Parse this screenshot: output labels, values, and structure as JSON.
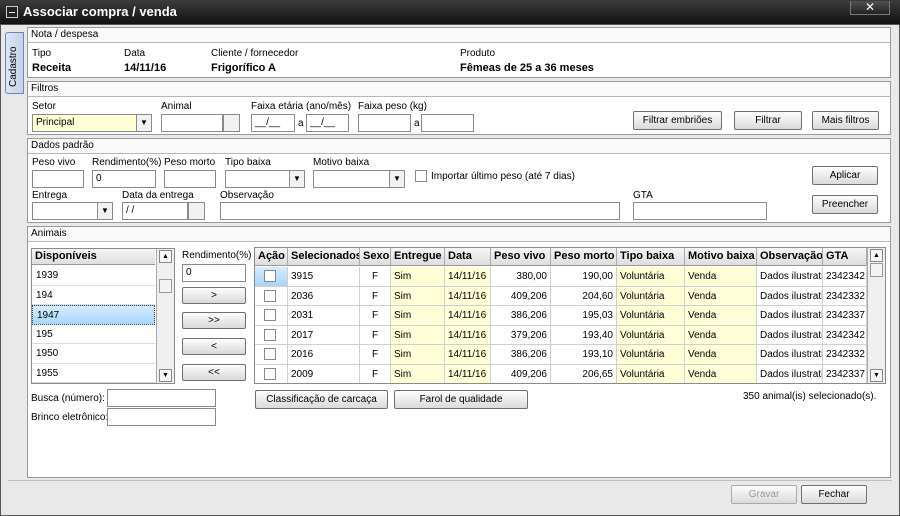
{
  "window": {
    "title": "Associar compra / venda",
    "close": "✕",
    "side_tab": "Cadastro"
  },
  "nota": {
    "section": "Nota / despesa",
    "tipo_label": "Tipo",
    "tipo": "Receita",
    "data_label": "Data",
    "data": "14/11/16",
    "cliente_label": "Cliente / fornecedor",
    "cliente": "Frigorífico A",
    "produto_label": "Produto",
    "produto": "Fêmeas de 25 a 36 meses"
  },
  "filtros": {
    "section": "Filtros",
    "setor_label": "Setor",
    "setor": "Principal",
    "animal_label": "Animal",
    "faixa_etaria_label": "Faixa etária (ano/mês)",
    "faixa_from": "__/__",
    "faixa_sep": "a",
    "faixa_to": "__/__",
    "faixa_peso_label": "Faixa peso (kg)",
    "peso_sep": "a",
    "btn_embrioes": "Filtrar embriões",
    "btn_filtrar": "Filtrar",
    "btn_mais": "Mais filtros"
  },
  "padrao": {
    "section": "Dados padrão",
    "peso_vivo_label": "Peso vivo",
    "rendimento_label": "Rendimento(%)",
    "rendimento": "0",
    "peso_morto_label": "Peso morto",
    "tipo_baixa_label": "Tipo baixa",
    "motivo_baixa_label": "Motivo baixa",
    "importar_label": "Importar último peso (até 7 dias)",
    "entrega_label": "Entrega",
    "data_entrega_label": "Data da entrega",
    "data_entrega": " / /",
    "observacao_label": "Observação",
    "gta_label": "GTA",
    "btn_aplicar": "Aplicar",
    "btn_preencher": "Preencher"
  },
  "animais": {
    "section": "Animais",
    "disponiveis_header": "Disponíveis",
    "disponiveis": [
      "1939",
      "194",
      "1947",
      "195",
      "1950",
      "1955"
    ],
    "rendimento_label": "Rendimento(%)",
    "rendimento": "0",
    "btn_add": ">",
    "btn_add_all": ">>",
    "btn_remove": "<",
    "btn_remove_all": "<<",
    "columns": [
      "Ação",
      "Selecionados",
      "Sexo",
      "Entregue",
      "Data",
      "Peso vivo",
      "Peso morto",
      "Tipo baixa",
      "Motivo baixa",
      "Observação",
      "GTA"
    ],
    "rows": [
      [
        "3915",
        "F",
        "Sim",
        "14/11/16",
        "380,00",
        "190,00",
        "Voluntária",
        "Venda",
        "Dados ilustrativ",
        "2342342"
      ],
      [
        "2036",
        "F",
        "Sim",
        "14/11/16",
        "409,206",
        "204,60",
        "Voluntária",
        "Venda",
        "Dados ilustrativ",
        "2342332"
      ],
      [
        "2031",
        "F",
        "Sim",
        "14/11/16",
        "386,206",
        "195,03",
        "Voluntária",
        "Venda",
        "Dados ilustrativ",
        "2342337"
      ],
      [
        "2017",
        "F",
        "Sim",
        "14/11/16",
        "379,206",
        "193,40",
        "Voluntária",
        "Venda",
        "Dados ilustrativ",
        "2342342"
      ],
      [
        "2016",
        "F",
        "Sim",
        "14/11/16",
        "386,206",
        "193,10",
        "Voluntária",
        "Venda",
        "Dados ilustrativ",
        "2342332"
      ],
      [
        "2009",
        "F",
        "Sim",
        "14/11/16",
        "409,206",
        "206,65",
        "Voluntária",
        "Venda",
        "Dados ilustrativ",
        "2342337"
      ]
    ],
    "busca_label": "Busca (número):",
    "brinco_label": "Brinco eletrônico:",
    "btn_classificacao": "Classificação de carcaça",
    "btn_farol": "Farol de qualidade",
    "selected_count": "350 animal(is) selecionado(s)."
  },
  "footer": {
    "btn_gravar": "Gravar",
    "btn_fechar": "Fechar"
  }
}
